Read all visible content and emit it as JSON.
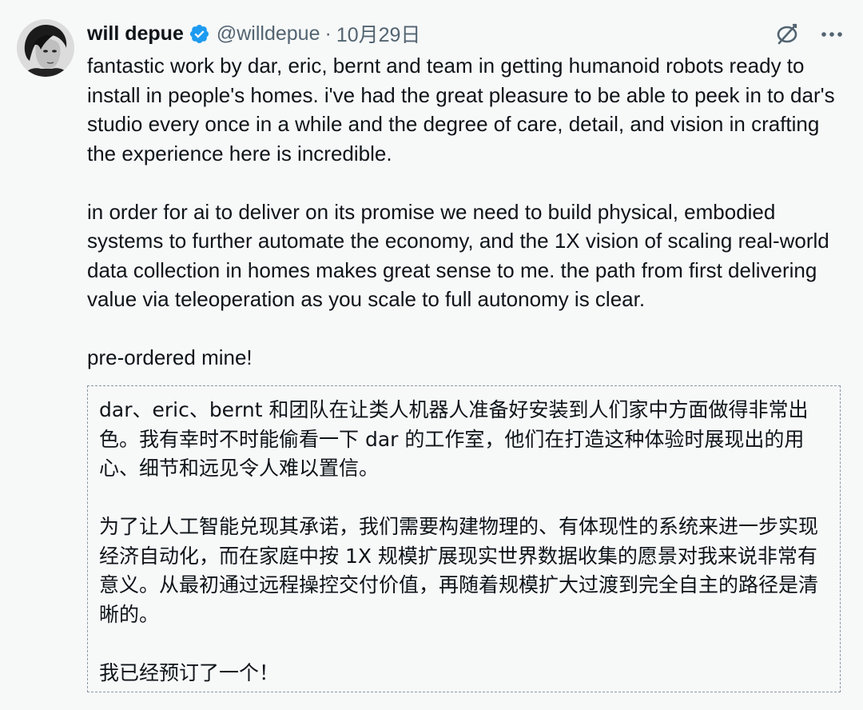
{
  "author": {
    "display_name": "will depue",
    "handle": "@willdepue",
    "separator": "·",
    "date": "10月29日",
    "verified": true,
    "avatar_icon": "user-avatar"
  },
  "actions": {
    "translate_icon": "translate-off-icon",
    "more_icon": "more-horizontal-icon"
  },
  "tweet": {
    "paragraphs": [
      "fantastic work by dar, eric, bernt and team in getting humanoid robots ready to install in people's homes. i've had the great pleasure to be able to peek in to dar's studio every once in a while and the degree of care, detail, and vision in crafting the experience here is incredible.",
      "in order for ai to deliver on its promise we need to build physical, embodied systems to further automate the economy, and the 1X vision of scaling real-world data collection in homes makes great sense to me. the path from first delivering value via teleoperation as you scale to full autonomy is clear.",
      "pre-ordered mine!"
    ]
  },
  "translation": {
    "paragraphs": [
      "dar、eric、bernt 和团队在让类人机器人准备好安装到人们家中方面做得非常出色。我有幸时不时能偷看一下 dar 的工作室，他们在打造这种体验时展现出的用心、细节和远见令人难以置信。",
      "为了让人工智能兑现其承诺，我们需要构建物理的、有体现性的系统来进一步实现经济自动化，而在家庭中按 1X 规模扩展现实世界数据收集的愿景对我来说非常有意义。从最初通过远程操控交付价值，再随着规模扩大过渡到完全自主的路径是清晰的。",
      "我已经预订了一个！"
    ]
  },
  "colors": {
    "background": "#f7f9f9",
    "text_primary": "#0f1419",
    "text_secondary": "#536471",
    "verified_blue": "#1d9bf0",
    "translation_border": "#8a97a6"
  }
}
